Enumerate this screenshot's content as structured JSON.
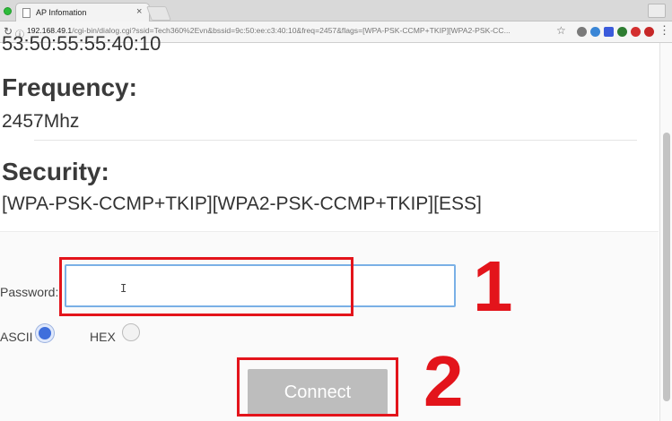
{
  "browser": {
    "tab_title": "AP Infomation",
    "tab_close": "×",
    "url_host": "192.168.49.1",
    "url_path": "/cgi-bin/dialog.cgi?ssid=Tech360%2Evn&bssid=9c:50:ee:c3:40:10&freq=2457&flags=[WPA-PSK-CCMP+TKIP][WPA2-PSK-CC...",
    "back_icon": "←",
    "reload_icon": "↻",
    "info_icon": "ⓘ",
    "star_icon": "☆",
    "extension_colors": [
      "#7a7a7a",
      "#3a86d6",
      "#d23b3b",
      "#2e7d32",
      "#3b5bdb",
      "#d32f2f",
      "#6b6b6b"
    ]
  },
  "details": {
    "partial_mac": "53:50:55:55:40:10",
    "frequency_heading": "Frequency:",
    "frequency_value": "2457Mhz",
    "security_heading": "Security:",
    "security_value": "[WPA-PSK-CCMP+TKIP][WPA2-PSK-CCMP+TKIP][ESS]"
  },
  "form": {
    "password_label": "Password:",
    "password_value": "",
    "text_cursor": "I",
    "ascii_label": "ASCII",
    "ascii_selected": true,
    "hex_label": "HEX",
    "hex_selected": false,
    "connect_label": "Connect"
  },
  "annotations": {
    "step1": "1",
    "step2": "2",
    "color": "#e3141b"
  }
}
